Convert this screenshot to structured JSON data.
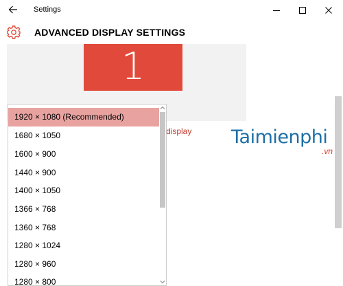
{
  "window": {
    "title": "Settings"
  },
  "header": {
    "title": "ADVANCED DISPLAY SETTINGS"
  },
  "display_preview": {
    "monitor_number": "1"
  },
  "link": {
    "text": "display"
  },
  "watermark": {
    "brand": "Taimienphi",
    "suffix": ".vn"
  },
  "resolution_dropdown": {
    "selected_index": 0,
    "options": [
      "1920 × 1080 (Recommended)",
      "1680 × 1050",
      "1600 × 900",
      "1440 × 900",
      "1400 × 1050",
      "1366 × 768",
      "1360 × 768",
      "1280 × 1024",
      "1280 × 960",
      "1280 × 800"
    ]
  },
  "colors": {
    "accent": "#e14a3a",
    "selected_item": "#e8a3a0",
    "link": "#c0392b",
    "watermark_blue": "#1c6fa8",
    "watermark_red": "#e03c2b"
  }
}
